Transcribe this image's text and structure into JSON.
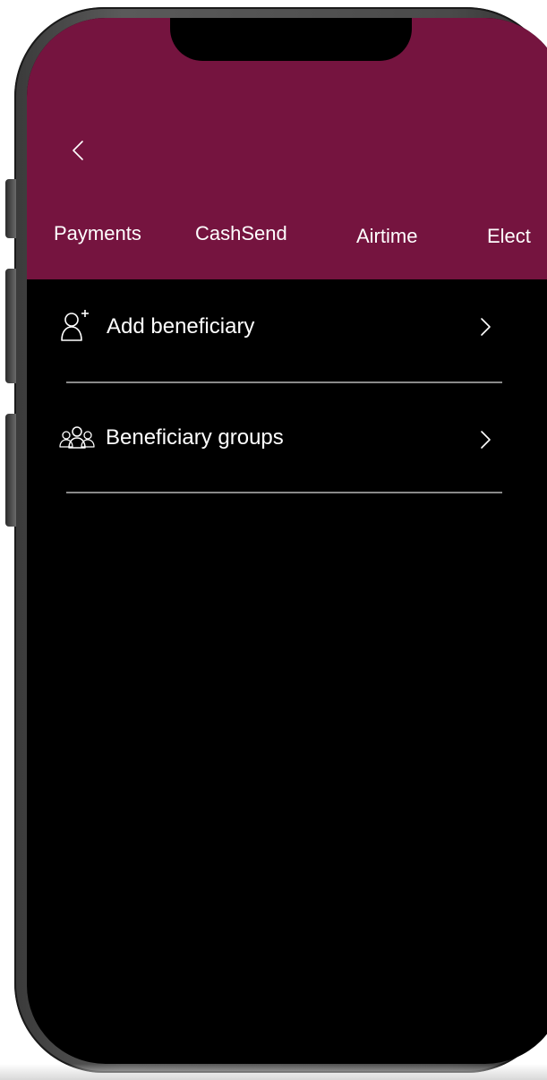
{
  "header": {
    "background_color": "#75143f",
    "back_icon": "chevron-left-icon"
  },
  "tabs": [
    {
      "label": "Payments"
    },
    {
      "label": "CashSend"
    },
    {
      "label": "Airtime"
    },
    {
      "label": "Elect"
    }
  ],
  "menu": {
    "items": [
      {
        "label": "Add beneficiary",
        "icon": "add-person-icon",
        "chevron": "chevron-right-icon"
      },
      {
        "label": "Beneficiary groups",
        "icon": "group-icon",
        "chevron": "chevron-right-icon"
      }
    ]
  },
  "colors": {
    "screen_background": "#000000",
    "text": "#ffffff",
    "divider": "#8a8a8a"
  }
}
